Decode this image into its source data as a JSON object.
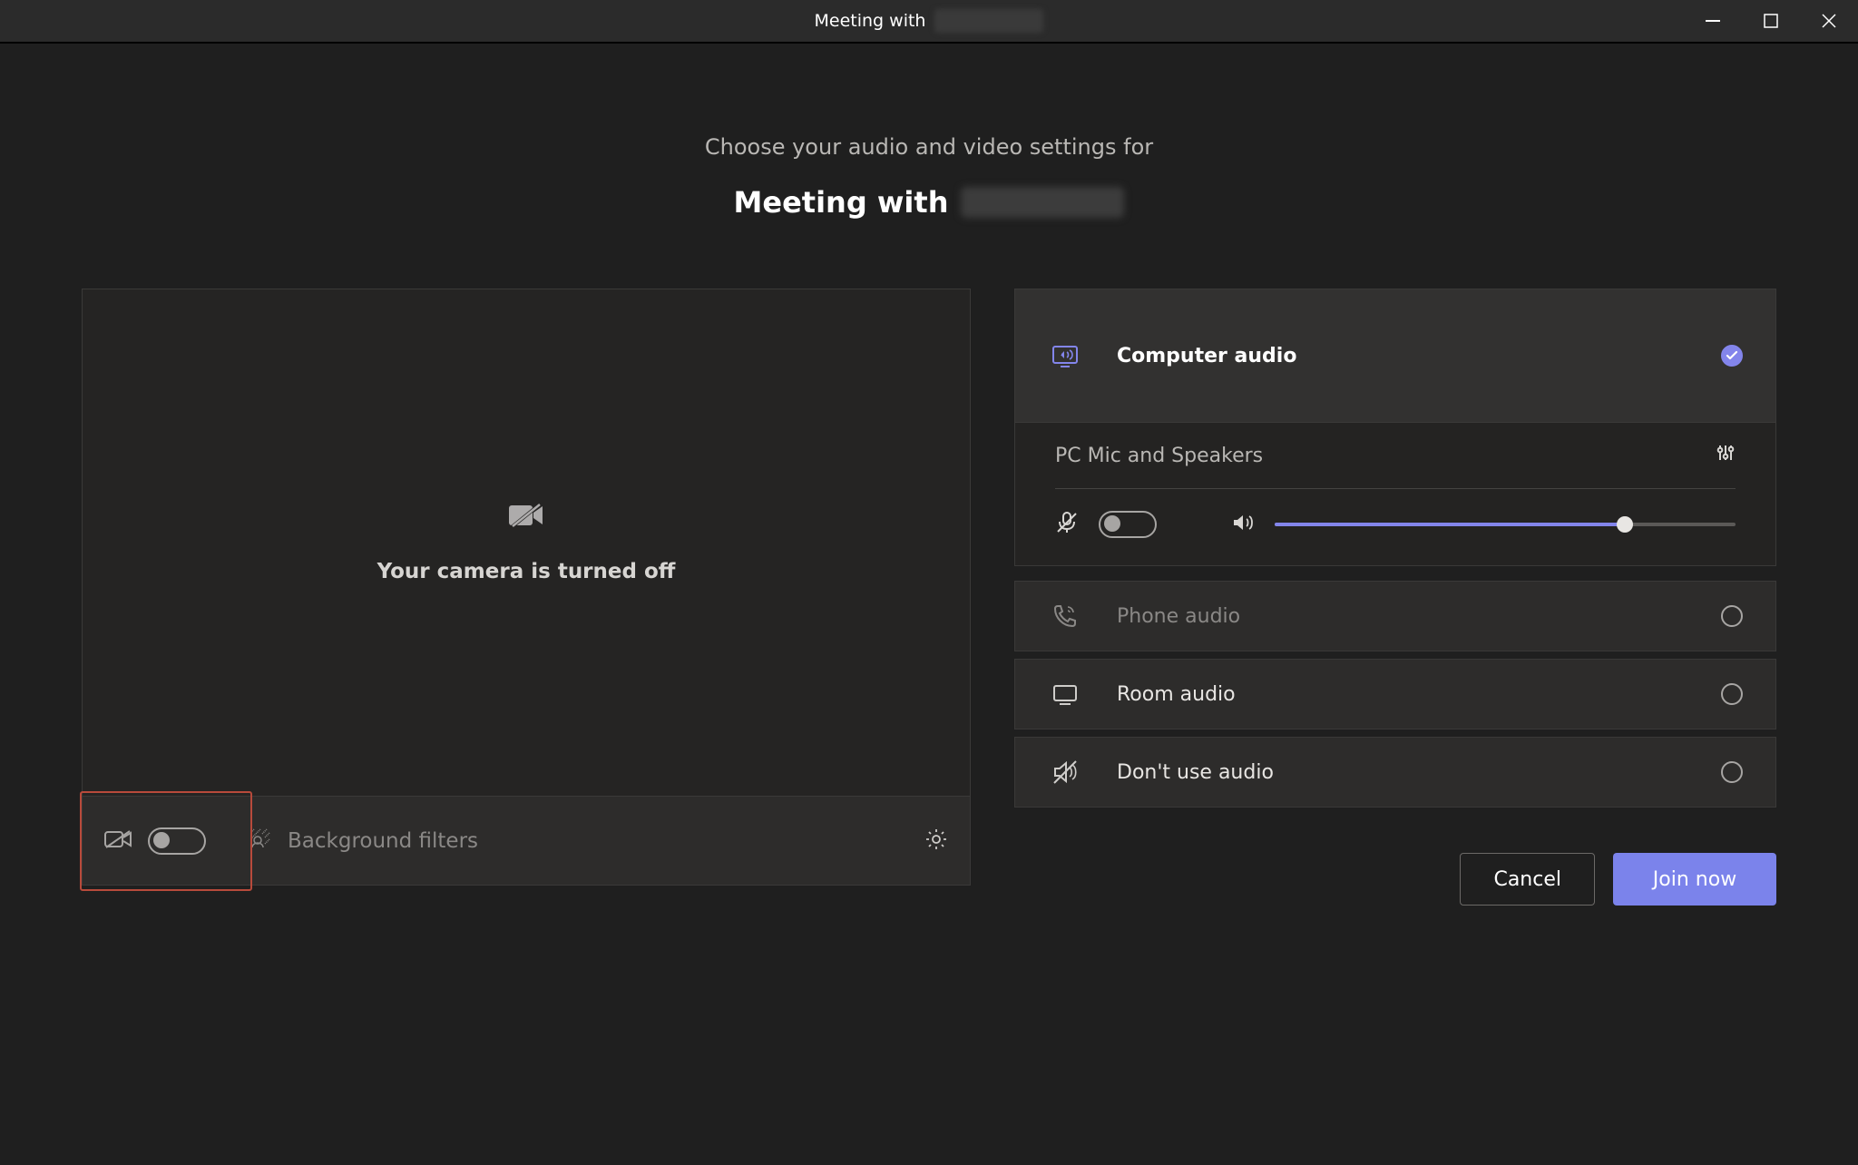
{
  "titlebar": {
    "title_prefix": "Meeting with"
  },
  "heading": {
    "sub": "Choose your audio and video settings for",
    "main_prefix": "Meeting with"
  },
  "video": {
    "camera_off_msg": "Your camera is turned off",
    "background_filters": "Background filters"
  },
  "audio": {
    "computer_audio": "Computer audio",
    "device": "PC Mic and Speakers",
    "volume_percent": 76,
    "phone_audio": "Phone audio",
    "room_audio": "Room audio",
    "no_audio": "Don't use audio"
  },
  "footer": {
    "cancel": "Cancel",
    "join": "Join now"
  }
}
